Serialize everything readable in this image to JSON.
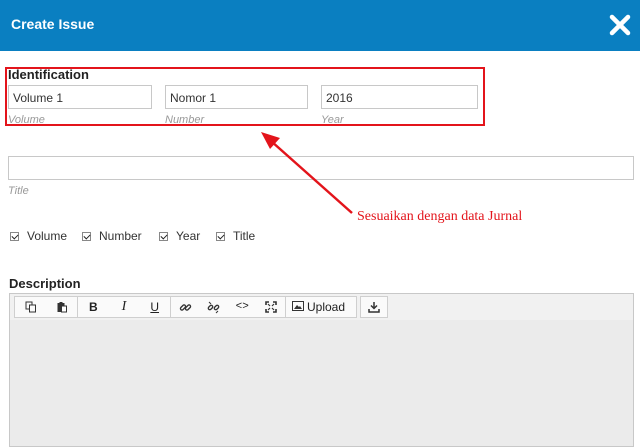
{
  "dialog": {
    "title": "Create Issue",
    "close_icon": "close-icon"
  },
  "identification": {
    "heading": "Identification",
    "volume": {
      "value": "Volume 1",
      "label": "Volume"
    },
    "number": {
      "value": "Nomor 1",
      "label": "Number"
    },
    "year": {
      "value": "2016",
      "label": "Year"
    }
  },
  "title_field": {
    "value": "",
    "label": "Title"
  },
  "annotation": {
    "text": "Sesuaikan dengan data Jurnal",
    "color": "#e3141b"
  },
  "show_options": [
    {
      "label": "Volume",
      "checked": true
    },
    {
      "label": "Number",
      "checked": true
    },
    {
      "label": "Year",
      "checked": true
    },
    {
      "label": "Title",
      "checked": true
    }
  ],
  "description": {
    "heading": "Description",
    "toolbar": {
      "copy_icon": "copy-icon",
      "paste_icon": "paste-icon",
      "bold": "B",
      "italic": "I",
      "underline": "U",
      "link_icon": "link-icon",
      "unlink_icon": "unlink-icon",
      "code": "<>",
      "fullscreen_icon": "fullscreen-icon",
      "upload_label": "Upload",
      "download_icon": "download-icon"
    }
  },
  "colors": {
    "header": "#0a7fc1",
    "highlight": "#e3141b"
  }
}
